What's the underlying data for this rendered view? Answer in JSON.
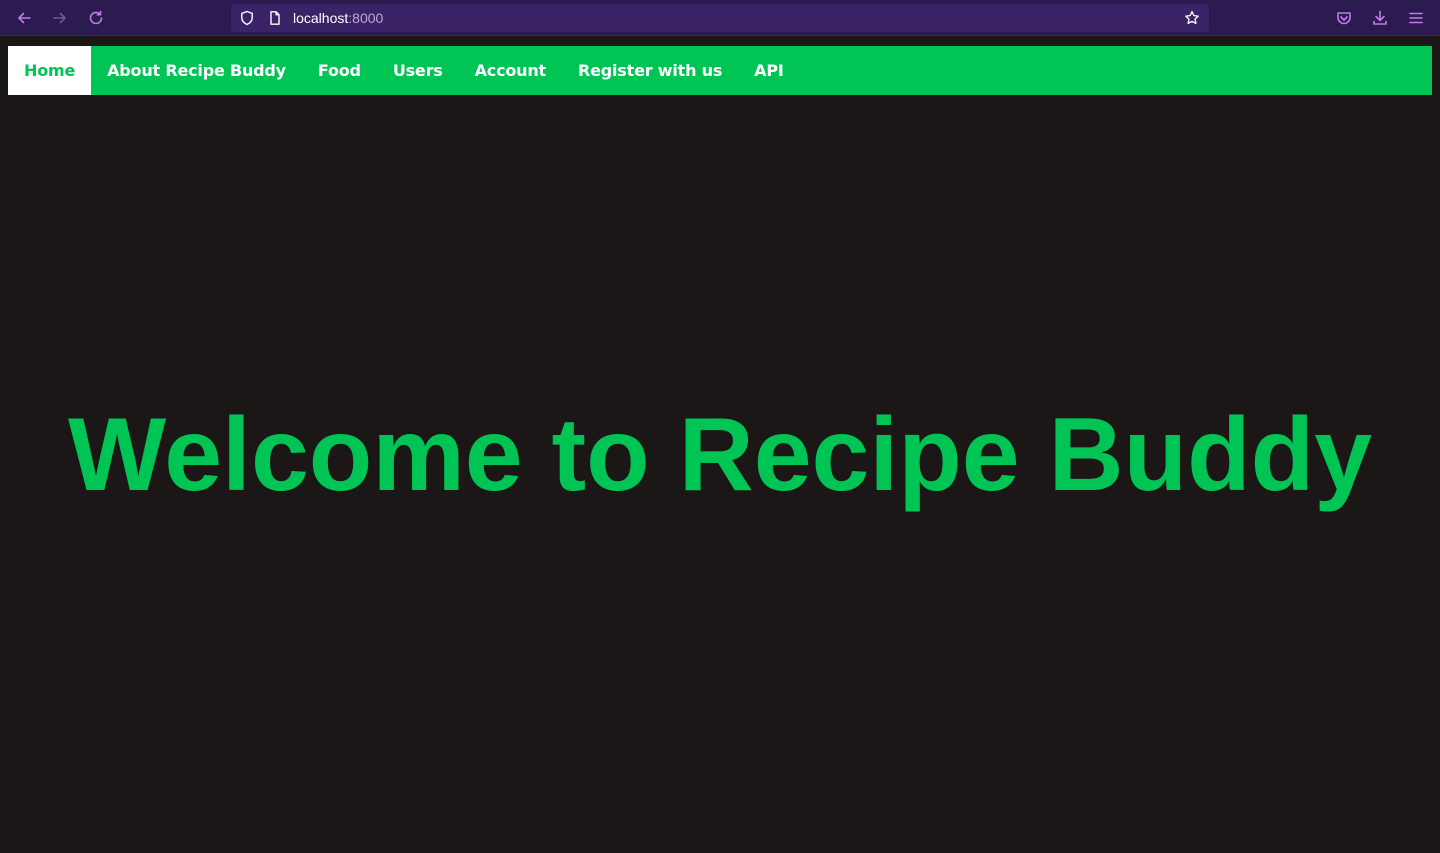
{
  "browser": {
    "url_host": "localhost",
    "url_port": ":8000",
    "icons": {
      "back": "back-arrow-icon",
      "forward": "forward-arrow-icon",
      "reload": "reload-icon",
      "shield": "shield-icon",
      "page": "page-icon",
      "bookmark": "star-icon",
      "pocket": "pocket-icon",
      "downloads": "download-icon",
      "menu": "hamburger-menu-icon"
    },
    "colors": {
      "chrome_bg": "#2b1b51",
      "url_bg": "#3a2467",
      "icon_accent": "#c17be8"
    }
  },
  "nav": {
    "items": [
      {
        "label": "Home",
        "active": true
      },
      {
        "label": "About Recipe Buddy",
        "active": false
      },
      {
        "label": "Food",
        "active": false
      },
      {
        "label": "Users",
        "active": false
      },
      {
        "label": "Account",
        "active": false
      },
      {
        "label": "Register with us",
        "active": false
      },
      {
        "label": "API",
        "active": false
      }
    ]
  },
  "main": {
    "title": "Welcome to Recipe Buddy"
  },
  "colors": {
    "accent": "#00c454",
    "page_bg": "#1c1717",
    "nav_text": "#ffffff"
  }
}
